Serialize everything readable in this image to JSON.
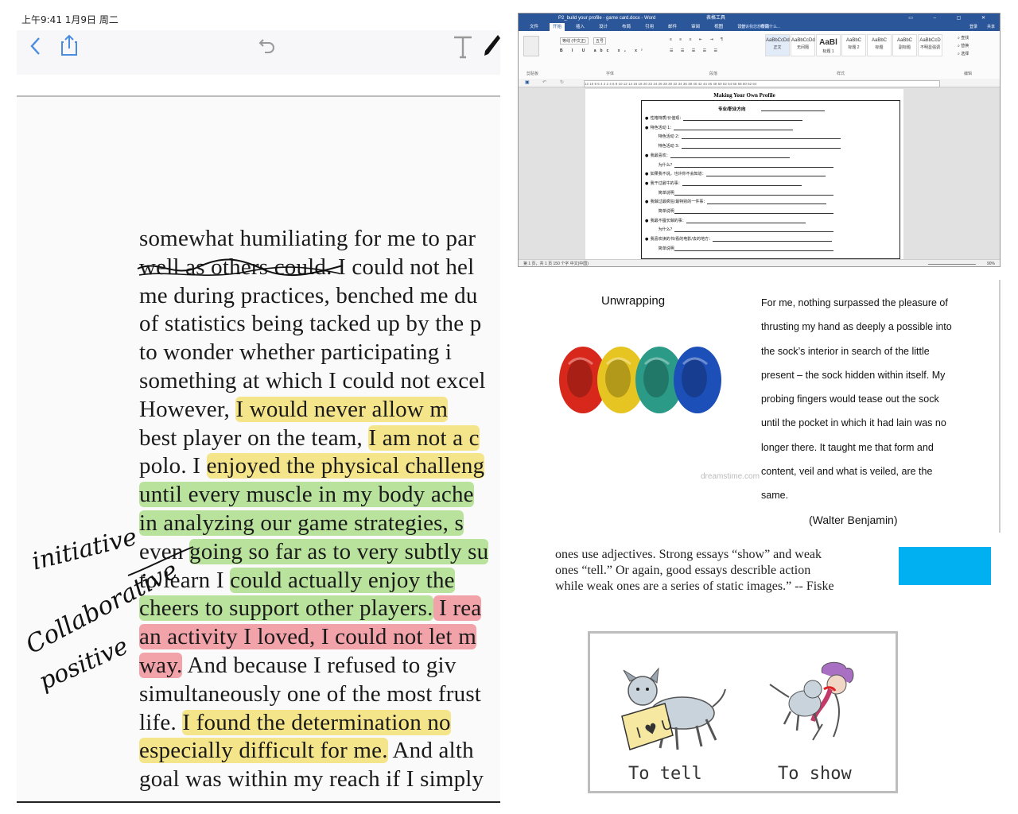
{
  "reader": {
    "status_time": "上午9:41  1月9日 周二",
    "icons": {
      "back": "chevron-left-icon",
      "share": "share-icon",
      "undo": "undo-icon",
      "text": "text-tool-icon",
      "pen": "pen-icon"
    },
    "lines": [
      [
        {
          "t": "somewhat humiliating for me to par",
          "h": ""
        }
      ],
      [
        {
          "t": "well as others could",
          "h": "strike"
        },
        {
          "t": ". I could not hel",
          "h": ""
        }
      ],
      [
        {
          "t": "me during practices, benched me du",
          "h": ""
        }
      ],
      [
        {
          "t": "of statistics being tacked up by the p",
          "h": ""
        }
      ],
      [
        {
          "t": "to  wonder  whether  participating  i",
          "h": ""
        }
      ],
      [
        {
          "t": "something at which I could not excel",
          "h": ""
        }
      ],
      [
        {
          "t": "    However, ",
          "h": ""
        },
        {
          "t": "I would never allow m",
          "h": "y"
        }
      ],
      [
        {
          "t": "best player on the team, ",
          "h": ""
        },
        {
          "t": "I am not a c",
          "h": "y"
        }
      ],
      [
        {
          "t": "polo. I ",
          "h": ""
        },
        {
          "t": "enjoyed the physical challeng",
          "h": "y"
        }
      ],
      [
        {
          "t": "until every muscle in my body ache",
          "h": "g"
        }
      ],
      [
        {
          "t": "in analyzing our game strategies, s",
          "h": "g"
        }
      ],
      [
        {
          "t": "even ",
          "h": ""
        },
        {
          "t": "going so far as to very subtly su",
          "h": "g"
        }
      ],
      [
        {
          "t": "to learn I ",
          "h": ""
        },
        {
          "t": "could actually enjoy the",
          "h": "g"
        }
      ],
      [
        {
          "t": "cheers to support other players.",
          "h": "g"
        },
        {
          "t": " I rea",
          "h": "r"
        }
      ],
      [
        {
          "t": "an activity I loved, I could not let m",
          "h": "r"
        }
      ],
      [
        {
          "t": "way.",
          "h": "r"
        },
        {
          "t": " And because I refused to giv",
          "h": ""
        }
      ],
      [
        {
          "t": "simultaneously one of the most frust",
          "h": ""
        }
      ],
      [
        {
          "t": "life. ",
          "h": ""
        },
        {
          "t": "I found the determination no",
          "h": "y"
        }
      ],
      [
        {
          "t": "especially difficult for me.",
          "h": "y"
        },
        {
          "t": " And alth",
          "h": ""
        }
      ],
      [
        {
          "t": "goal was within my reach if I simply",
          "h": ""
        }
      ]
    ],
    "annotations": [
      "initiative",
      "Collaborative",
      "positive"
    ]
  },
  "word": {
    "title": "P2_build your profile - game card.docx - Word",
    "tool_context": "表格工具",
    "tabs": [
      "文件",
      "开始",
      "插入",
      "设计",
      "布局",
      "引用",
      "邮件",
      "审阅",
      "视图",
      "设计",
      "布局"
    ],
    "active_tab": "开始",
    "tell_me": "告诉我您想要做什么...",
    "signin": "登录",
    "share": "共享",
    "ribbon_groups": [
      "剪贴板",
      "字体",
      "段落",
      "样式",
      "编辑"
    ],
    "font_name": "等线 (中文正)",
    "font_size": "五号",
    "styles": [
      {
        "sample": "AaBbCcDd",
        "name": "正文"
      },
      {
        "sample": "AaBbCcDd",
        "name": "无间隔"
      },
      {
        "sample": "AaBl",
        "name": "标题 1"
      },
      {
        "sample": "AaBbC",
        "name": "标题 2"
      },
      {
        "sample": "AaBbC",
        "name": "标题"
      },
      {
        "sample": "AaBbC",
        "name": "副标题"
      },
      {
        "sample": "AaBbCcD",
        "name": "不明显强调"
      }
    ],
    "edit_actions": [
      "查找",
      "替换",
      "选择"
    ],
    "ruler": "12 10 8 6 4 2   2 4 6 8 10 12 14 16 18 20 22 24 26 28 30 32 34 36 38 40 42 44 46 48 50 52 54 56 58 60 62 64",
    "doc_title": "Making Your Own Profile",
    "doc_subtitle": "专业/职业方向",
    "rows": [
      {
        "b": true,
        "t": "性格特质/价值观："
      },
      {
        "b": true,
        "t": "特色活动 1："
      },
      {
        "b": false,
        "t": "特色活动 2："
      },
      {
        "b": false,
        "t": "特色活动 3："
      },
      {
        "b": true,
        "t": "我最喜欢："
      },
      {
        "b": false,
        "t": "为什么？"
      },
      {
        "b": true,
        "t": "如果我不说，也许你不会知道："
      },
      {
        "b": true,
        "t": "我干过最牛的事："
      },
      {
        "b": false,
        "t": "简单说明"
      },
      {
        "b": true,
        "t": "我做过最疯狂/最特别的一件事："
      },
      {
        "b": false,
        "t": "简单说明"
      },
      {
        "b": true,
        "t": "我最不擅长做的事："
      },
      {
        "b": false,
        "t": "为什么？"
      },
      {
        "b": true,
        "t": "我喜欢读的书/看的电影/去的地方："
      },
      {
        "b": false,
        "t": "简单说明"
      }
    ],
    "status": "第 1 页，共 1 页    150 个字    中文(中国)",
    "zoom": "90%"
  },
  "quote": {
    "title": "Unwrapping",
    "body": "For me, nothing surpassed the pleasure of thrusting my hand as deeply a possible into the sock’s interior in search of the little present – the sock hidden within itself. My probing fingers would tease out the sock until the pocket in which it had lain was no longer there. It taught me that form and content, veil and what is veiled, are the same.",
    "author": "(Walter Benjamin)",
    "watermark": "dreamstime.com",
    "sock_colors": [
      "#d8281c",
      "#e6c522",
      "#2b9a86",
      "#1d4fb8"
    ]
  },
  "fiske": {
    "text": "ones use adjectives. Strong essays “show” and weak ones “tell.” Or again, good essays describle action while weak ones are a series of static images.” -- Fiske",
    "accent": "#00b0f0",
    "captions": {
      "tell": "To tell",
      "show": "To show"
    },
    "sign_text": "I ♥ U"
  }
}
